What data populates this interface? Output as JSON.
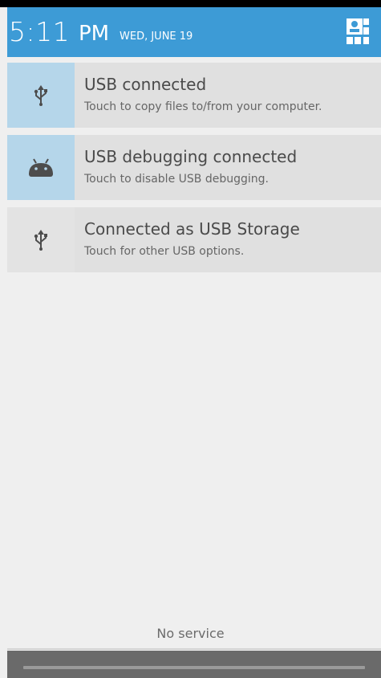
{
  "header": {
    "time": "5:11",
    "ampm": "PM",
    "date": "WED, JUNE 19",
    "background_color": "#3d9bd6",
    "quick_settings_icon": "quick-settings-icon"
  },
  "notifications": [
    {
      "title": "USB connected",
      "subtitle": "Touch to copy files to/from your computer.",
      "icon": "usb-icon"
    },
    {
      "title": "USB debugging connected",
      "subtitle": "Touch to disable USB debugging.",
      "icon": "android-debug-icon"
    },
    {
      "title": "Connected as USB Storage",
      "subtitle": "Touch for other USB options.",
      "icon": "usb-icon"
    }
  ],
  "footer": {
    "service_text": "No service"
  }
}
